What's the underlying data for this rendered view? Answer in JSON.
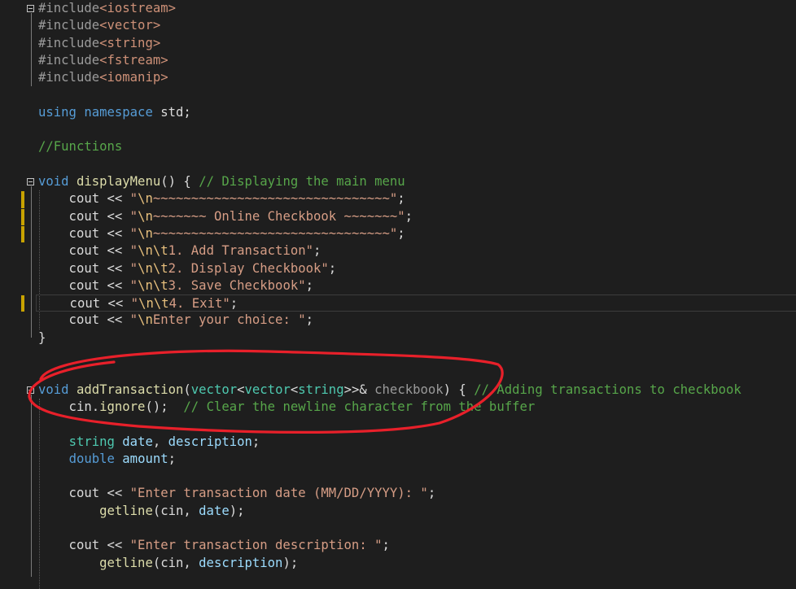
{
  "editor": {
    "lines": [
      {
        "tokens": [
          {
            "c": "pp",
            "t": "#include"
          },
          {
            "c": "inc",
            "t": "<iostream>"
          }
        ]
      },
      {
        "tokens": [
          {
            "c": "pp",
            "t": "#include"
          },
          {
            "c": "inc",
            "t": "<vector>"
          }
        ]
      },
      {
        "tokens": [
          {
            "c": "pp",
            "t": "#include"
          },
          {
            "c": "inc",
            "t": "<string>"
          }
        ]
      },
      {
        "tokens": [
          {
            "c": "pp",
            "t": "#include"
          },
          {
            "c": "inc",
            "t": "<fstream>"
          }
        ]
      },
      {
        "tokens": [
          {
            "c": "pp",
            "t": "#include"
          },
          {
            "c": "inc",
            "t": "<iomanip>"
          }
        ]
      },
      {
        "tokens": []
      },
      {
        "tokens": [
          {
            "c": "kw",
            "t": "using"
          },
          {
            "c": "id",
            "t": " "
          },
          {
            "c": "kw",
            "t": "namespace"
          },
          {
            "c": "id",
            "t": " std;"
          }
        ]
      },
      {
        "tokens": []
      },
      {
        "tokens": [
          {
            "c": "cm",
            "t": "//Functions"
          }
        ]
      },
      {
        "tokens": []
      },
      {
        "tokens": [
          {
            "c": "kw",
            "t": "void"
          },
          {
            "c": "id",
            "t": " "
          },
          {
            "c": "fn",
            "t": "displayMenu"
          },
          {
            "c": "id",
            "t": "() { "
          },
          {
            "c": "cm",
            "t": "// Displaying the main menu"
          }
        ]
      },
      {
        "tokens": [
          {
            "c": "id",
            "t": "    cout << "
          },
          {
            "c": "st",
            "t": "\""
          },
          {
            "c": "es",
            "t": "\\n"
          },
          {
            "c": "st",
            "t": "~~~~~~~~~~~~~~~~~~~~~~~~~~~~~~~\""
          },
          {
            "c": "id",
            "t": ";"
          }
        ]
      },
      {
        "tokens": [
          {
            "c": "id",
            "t": "    cout << "
          },
          {
            "c": "st",
            "t": "\""
          },
          {
            "c": "es",
            "t": "\\n"
          },
          {
            "c": "st",
            "t": "~~~~~~~ Online Checkbook ~~~~~~~\""
          },
          {
            "c": "id",
            "t": ";"
          }
        ]
      },
      {
        "tokens": [
          {
            "c": "id",
            "t": "    cout << "
          },
          {
            "c": "st",
            "t": "\""
          },
          {
            "c": "es",
            "t": "\\n"
          },
          {
            "c": "st",
            "t": "~~~~~~~~~~~~~~~~~~~~~~~~~~~~~~~\""
          },
          {
            "c": "id",
            "t": ";"
          }
        ]
      },
      {
        "tokens": [
          {
            "c": "id",
            "t": "    cout << "
          },
          {
            "c": "st",
            "t": "\""
          },
          {
            "c": "es",
            "t": "\\n\\t"
          },
          {
            "c": "st",
            "t": "1. Add Transaction\""
          },
          {
            "c": "id",
            "t": ";"
          }
        ]
      },
      {
        "tokens": [
          {
            "c": "id",
            "t": "    cout << "
          },
          {
            "c": "st",
            "t": "\""
          },
          {
            "c": "es",
            "t": "\\n\\t"
          },
          {
            "c": "st",
            "t": "2. Display Checkbook\""
          },
          {
            "c": "id",
            "t": ";"
          }
        ]
      },
      {
        "tokens": [
          {
            "c": "id",
            "t": "    cout << "
          },
          {
            "c": "st",
            "t": "\""
          },
          {
            "c": "es",
            "t": "\\n\\t"
          },
          {
            "c": "st",
            "t": "3. Save Checkbook\""
          },
          {
            "c": "id",
            "t": ";"
          }
        ]
      },
      {
        "tokens": [
          {
            "c": "id",
            "t": "    cout << "
          },
          {
            "c": "st",
            "t": "\""
          },
          {
            "c": "es",
            "t": "\\n\\t"
          },
          {
            "c": "st",
            "t": "4. Exit\""
          },
          {
            "c": "id",
            "t": ";"
          }
        ]
      },
      {
        "tokens": [
          {
            "c": "id",
            "t": "    cout << "
          },
          {
            "c": "st",
            "t": "\""
          },
          {
            "c": "es",
            "t": "\\n"
          },
          {
            "c": "st",
            "t": "Enter your choice: \""
          },
          {
            "c": "id",
            "t": ";"
          }
        ]
      },
      {
        "tokens": [
          {
            "c": "id",
            "t": "}"
          }
        ]
      },
      {
        "tokens": []
      },
      {
        "tokens": []
      },
      {
        "tokens": [
          {
            "c": "kw",
            "t": "void"
          },
          {
            "c": "id",
            "t": " "
          },
          {
            "c": "fn",
            "t": "addTransaction"
          },
          {
            "c": "id",
            "t": "("
          },
          {
            "c": "ty",
            "t": "vector"
          },
          {
            "c": "id",
            "t": "<"
          },
          {
            "c": "ty",
            "t": "vector"
          },
          {
            "c": "id",
            "t": "<"
          },
          {
            "c": "ty",
            "t": "string"
          },
          {
            "c": "id",
            "t": ">>& "
          },
          {
            "c": "par",
            "t": "checkbook"
          },
          {
            "c": "id",
            "t": ") { "
          },
          {
            "c": "cm",
            "t": "// Adding transactions to checkbook"
          }
        ]
      },
      {
        "tokens": [
          {
            "c": "id",
            "t": "    cin."
          },
          {
            "c": "fn",
            "t": "ignore"
          },
          {
            "c": "id",
            "t": "();  "
          },
          {
            "c": "cm",
            "t": "// Clear the newline character from the buffer"
          }
        ]
      },
      {
        "tokens": []
      },
      {
        "tokens": [
          {
            "c": "id",
            "t": "    "
          },
          {
            "c": "ty",
            "t": "string"
          },
          {
            "c": "id",
            "t": " "
          },
          {
            "c": "var",
            "t": "date"
          },
          {
            "c": "id",
            "t": ", "
          },
          {
            "c": "var",
            "t": "description"
          },
          {
            "c": "id",
            "t": ";"
          }
        ]
      },
      {
        "tokens": [
          {
            "c": "id",
            "t": "    "
          },
          {
            "c": "kw",
            "t": "double"
          },
          {
            "c": "id",
            "t": " "
          },
          {
            "c": "var",
            "t": "amount"
          },
          {
            "c": "id",
            "t": ";"
          }
        ]
      },
      {
        "tokens": []
      },
      {
        "tokens": [
          {
            "c": "id",
            "t": "    cout << "
          },
          {
            "c": "st",
            "t": "\"Enter transaction date (MM/DD/YYYY): \""
          },
          {
            "c": "id",
            "t": ";"
          }
        ]
      },
      {
        "tokens": [
          {
            "c": "id",
            "t": "        "
          },
          {
            "c": "fn",
            "t": "getline"
          },
          {
            "c": "id",
            "t": "(cin, "
          },
          {
            "c": "var",
            "t": "date"
          },
          {
            "c": "id",
            "t": ");"
          }
        ]
      },
      {
        "tokens": []
      },
      {
        "tokens": [
          {
            "c": "id",
            "t": "    cout << "
          },
          {
            "c": "st",
            "t": "\"Enter transaction description: \""
          },
          {
            "c": "id",
            "t": ";"
          }
        ]
      },
      {
        "tokens": [
          {
            "c": "id",
            "t": "        "
          },
          {
            "c": "fn",
            "t": "getline"
          },
          {
            "c": "id",
            "t": "(cin, "
          },
          {
            "c": "var",
            "t": "description"
          },
          {
            "c": "id",
            "t": ");"
          }
        ]
      },
      {
        "tokens": []
      }
    ],
    "fold_lines": [
      0,
      10,
      22
    ],
    "change_marker_lines": [
      11,
      12,
      13,
      17
    ],
    "current_line": 17,
    "colors": {
      "background": "#1e1e1e",
      "keyword": "#569cd6",
      "function": "#dcdcaa",
      "comment": "#57a64a",
      "string": "#d69d85",
      "escape": "#e8c07d",
      "type": "#4ec9b0",
      "variable": "#9cdcfe",
      "annotation": "#e8202a"
    }
  },
  "annotation": {
    "shape": "hand-drawn-ellipse",
    "color": "#e8202a",
    "target_line": 22
  }
}
